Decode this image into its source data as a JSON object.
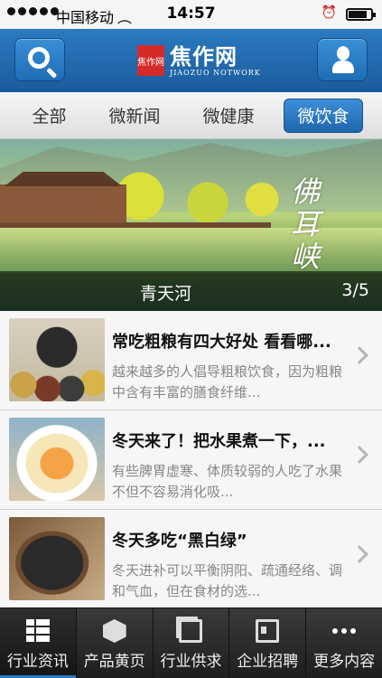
{
  "status_bar": {
    "carrier": "中国移动",
    "time": "14:57",
    "battery_level": 0.85
  },
  "header": {
    "logo_mark": "焦作网",
    "logo_cn": "焦作网",
    "logo_en": "JIAOZUO NOTWORK",
    "search_icon": "search-icon",
    "user_icon": "user-icon"
  },
  "tabs": [
    {
      "label": "全部",
      "active": false
    },
    {
      "label": "微新闻",
      "active": false
    },
    {
      "label": "微健康",
      "active": false
    },
    {
      "label": "微饮食",
      "active": true
    }
  ],
  "banner": {
    "calligraphy": "佛耳峡",
    "caption": "青天河",
    "counter": "3/5"
  },
  "articles": [
    {
      "title": "常吃粗粮有四大好处 看看哪...",
      "desc": "越来越多的人倡导粗粮饮食，因为粗粮中含有丰富的膳食纤维...",
      "thumb": "grains"
    },
    {
      "title": "冬天来了！把水果煮一下，...",
      "desc": "有些脾胃虚寒、体质较弱的人吃了水果不但不容易消化吸...",
      "thumb": "soup"
    },
    {
      "title": "冬天多吃“黑白绿”",
      "desc": "冬天进补可以平衡阴阳、疏通经络、调和气血，但在食材的选...",
      "thumb": "sesame"
    }
  ],
  "bottom_nav": [
    {
      "label": "行业资讯",
      "icon": "list-icon",
      "active": true
    },
    {
      "label": "产品黄页",
      "icon": "box-icon",
      "active": false
    },
    {
      "label": "行业供求",
      "icon": "layers-icon",
      "active": false
    },
    {
      "label": "企业招聘",
      "icon": "id-card-icon",
      "active": false
    },
    {
      "label": "更多内容",
      "icon": "more-icon",
      "active": false
    }
  ]
}
